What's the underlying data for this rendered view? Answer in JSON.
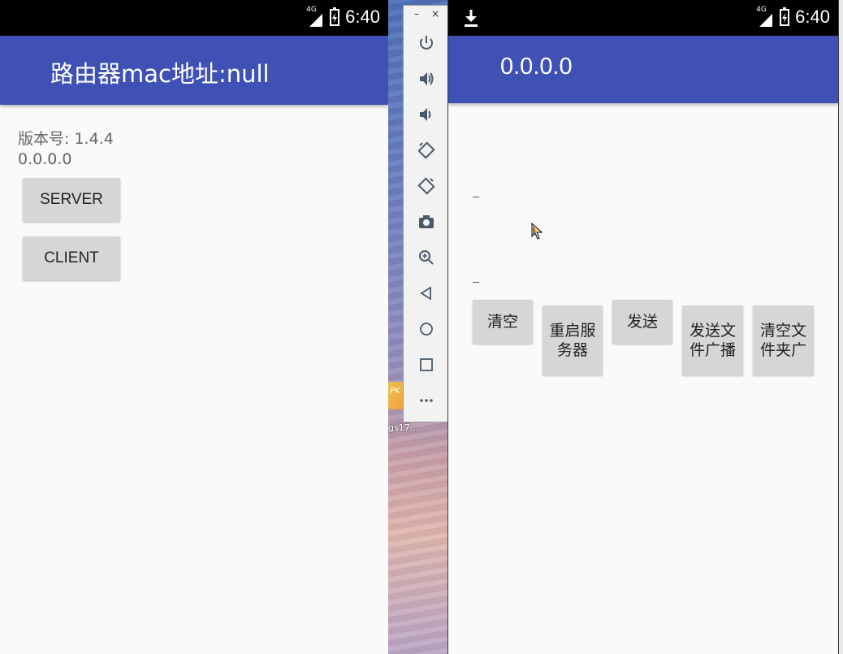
{
  "left_app": {
    "status_time": "6:40",
    "network": "4G",
    "title": "路由器mac地址:null",
    "version": "版本号: 1.4.4",
    "ip": "0.0.0.0",
    "server_button": "SERVER",
    "client_button": "CLIENT"
  },
  "toolbar": {
    "minimize": "–",
    "close": "×",
    "icons": [
      "power-icon",
      "volume-up-icon",
      "volume-down-icon",
      "rotate-left-icon",
      "rotate-right-icon",
      "camera-icon",
      "zoom-icon",
      "back-icon",
      "home-icon",
      "overview-icon",
      "more-icon"
    ]
  },
  "desktop": {
    "shortcut_text": "PK",
    "shortcut_label": "gs17..."
  },
  "right_app": {
    "status_time": "6:40",
    "network": "4G",
    "title": "0.0.0.0",
    "buttons": {
      "clear": "清空",
      "restart_server": "重启服务器",
      "send": "发送",
      "send_file_broadcast": "发送文件广播",
      "clear_folder_broadcast": "清空文件夹广"
    }
  },
  "colors": {
    "appbar": "#3f51b5",
    "statusbar": "#000000",
    "button": "#d6d6d6",
    "background": "#fafafa"
  }
}
